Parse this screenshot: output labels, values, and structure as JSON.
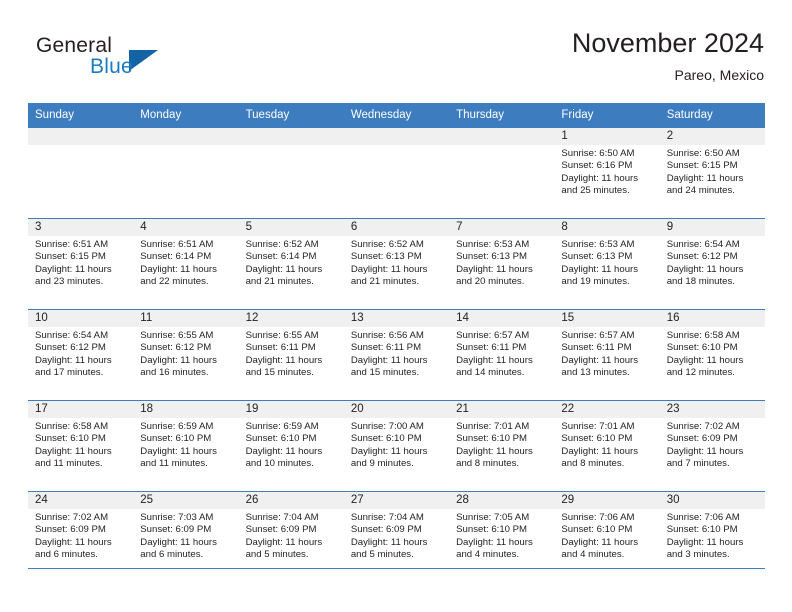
{
  "brand": {
    "word_one": "General",
    "word_two": "Blue",
    "triangle_icon": "triangle-icon",
    "accent_color": "#1d7bc1",
    "triangle_color": "#1464a5"
  },
  "header": {
    "title": "November 2024",
    "location": "Pareo, Mexico"
  },
  "calendar": {
    "header_color": "#3c7cbf",
    "daynum_band_color": "#f0f0f0",
    "weekdays": [
      "Sunday",
      "Monday",
      "Tuesday",
      "Wednesday",
      "Thursday",
      "Friday",
      "Saturday"
    ],
    "weeks": [
      [
        {
          "day": "",
          "blank": true
        },
        {
          "day": "",
          "blank": true
        },
        {
          "day": "",
          "blank": true
        },
        {
          "day": "",
          "blank": true
        },
        {
          "day": "",
          "blank": true
        },
        {
          "day": "1",
          "sunrise": "Sunrise: 6:50 AM",
          "sunset": "Sunset: 6:16 PM",
          "daylight1": "Daylight: 11 hours",
          "daylight2": "and 25 minutes."
        },
        {
          "day": "2",
          "sunrise": "Sunrise: 6:50 AM",
          "sunset": "Sunset: 6:15 PM",
          "daylight1": "Daylight: 11 hours",
          "daylight2": "and 24 minutes."
        }
      ],
      [
        {
          "day": "3",
          "sunrise": "Sunrise: 6:51 AM",
          "sunset": "Sunset: 6:15 PM",
          "daylight1": "Daylight: 11 hours",
          "daylight2": "and 23 minutes."
        },
        {
          "day": "4",
          "sunrise": "Sunrise: 6:51 AM",
          "sunset": "Sunset: 6:14 PM",
          "daylight1": "Daylight: 11 hours",
          "daylight2": "and 22 minutes."
        },
        {
          "day": "5",
          "sunrise": "Sunrise: 6:52 AM",
          "sunset": "Sunset: 6:14 PM",
          "daylight1": "Daylight: 11 hours",
          "daylight2": "and 21 minutes."
        },
        {
          "day": "6",
          "sunrise": "Sunrise: 6:52 AM",
          "sunset": "Sunset: 6:13 PM",
          "daylight1": "Daylight: 11 hours",
          "daylight2": "and 21 minutes."
        },
        {
          "day": "7",
          "sunrise": "Sunrise: 6:53 AM",
          "sunset": "Sunset: 6:13 PM",
          "daylight1": "Daylight: 11 hours",
          "daylight2": "and 20 minutes."
        },
        {
          "day": "8",
          "sunrise": "Sunrise: 6:53 AM",
          "sunset": "Sunset: 6:13 PM",
          "daylight1": "Daylight: 11 hours",
          "daylight2": "and 19 minutes."
        },
        {
          "day": "9",
          "sunrise": "Sunrise: 6:54 AM",
          "sunset": "Sunset: 6:12 PM",
          "daylight1": "Daylight: 11 hours",
          "daylight2": "and 18 minutes."
        }
      ],
      [
        {
          "day": "10",
          "sunrise": "Sunrise: 6:54 AM",
          "sunset": "Sunset: 6:12 PM",
          "daylight1": "Daylight: 11 hours",
          "daylight2": "and 17 minutes."
        },
        {
          "day": "11",
          "sunrise": "Sunrise: 6:55 AM",
          "sunset": "Sunset: 6:12 PM",
          "daylight1": "Daylight: 11 hours",
          "daylight2": "and 16 minutes."
        },
        {
          "day": "12",
          "sunrise": "Sunrise: 6:55 AM",
          "sunset": "Sunset: 6:11 PM",
          "daylight1": "Daylight: 11 hours",
          "daylight2": "and 15 minutes."
        },
        {
          "day": "13",
          "sunrise": "Sunrise: 6:56 AM",
          "sunset": "Sunset: 6:11 PM",
          "daylight1": "Daylight: 11 hours",
          "daylight2": "and 15 minutes."
        },
        {
          "day": "14",
          "sunrise": "Sunrise: 6:57 AM",
          "sunset": "Sunset: 6:11 PM",
          "daylight1": "Daylight: 11 hours",
          "daylight2": "and 14 minutes."
        },
        {
          "day": "15",
          "sunrise": "Sunrise: 6:57 AM",
          "sunset": "Sunset: 6:11 PM",
          "daylight1": "Daylight: 11 hours",
          "daylight2": "and 13 minutes."
        },
        {
          "day": "16",
          "sunrise": "Sunrise: 6:58 AM",
          "sunset": "Sunset: 6:10 PM",
          "daylight1": "Daylight: 11 hours",
          "daylight2": "and 12 minutes."
        }
      ],
      [
        {
          "day": "17",
          "sunrise": "Sunrise: 6:58 AM",
          "sunset": "Sunset: 6:10 PM",
          "daylight1": "Daylight: 11 hours",
          "daylight2": "and 11 minutes."
        },
        {
          "day": "18",
          "sunrise": "Sunrise: 6:59 AM",
          "sunset": "Sunset: 6:10 PM",
          "daylight1": "Daylight: 11 hours",
          "daylight2": "and 11 minutes."
        },
        {
          "day": "19",
          "sunrise": "Sunrise: 6:59 AM",
          "sunset": "Sunset: 6:10 PM",
          "daylight1": "Daylight: 11 hours",
          "daylight2": "and 10 minutes."
        },
        {
          "day": "20",
          "sunrise": "Sunrise: 7:00 AM",
          "sunset": "Sunset: 6:10 PM",
          "daylight1": "Daylight: 11 hours",
          "daylight2": "and 9 minutes."
        },
        {
          "day": "21",
          "sunrise": "Sunrise: 7:01 AM",
          "sunset": "Sunset: 6:10 PM",
          "daylight1": "Daylight: 11 hours",
          "daylight2": "and 8 minutes."
        },
        {
          "day": "22",
          "sunrise": "Sunrise: 7:01 AM",
          "sunset": "Sunset: 6:10 PM",
          "daylight1": "Daylight: 11 hours",
          "daylight2": "and 8 minutes."
        },
        {
          "day": "23",
          "sunrise": "Sunrise: 7:02 AM",
          "sunset": "Sunset: 6:09 PM",
          "daylight1": "Daylight: 11 hours",
          "daylight2": "and 7 minutes."
        }
      ],
      [
        {
          "day": "24",
          "sunrise": "Sunrise: 7:02 AM",
          "sunset": "Sunset: 6:09 PM",
          "daylight1": "Daylight: 11 hours",
          "daylight2": "and 6 minutes."
        },
        {
          "day": "25",
          "sunrise": "Sunrise: 7:03 AM",
          "sunset": "Sunset: 6:09 PM",
          "daylight1": "Daylight: 11 hours",
          "daylight2": "and 6 minutes."
        },
        {
          "day": "26",
          "sunrise": "Sunrise: 7:04 AM",
          "sunset": "Sunset: 6:09 PM",
          "daylight1": "Daylight: 11 hours",
          "daylight2": "and 5 minutes."
        },
        {
          "day": "27",
          "sunrise": "Sunrise: 7:04 AM",
          "sunset": "Sunset: 6:09 PM",
          "daylight1": "Daylight: 11 hours",
          "daylight2": "and 5 minutes."
        },
        {
          "day": "28",
          "sunrise": "Sunrise: 7:05 AM",
          "sunset": "Sunset: 6:10 PM",
          "daylight1": "Daylight: 11 hours",
          "daylight2": "and 4 minutes."
        },
        {
          "day": "29",
          "sunrise": "Sunrise: 7:06 AM",
          "sunset": "Sunset: 6:10 PM",
          "daylight1": "Daylight: 11 hours",
          "daylight2": "and 4 minutes."
        },
        {
          "day": "30",
          "sunrise": "Sunrise: 7:06 AM",
          "sunset": "Sunset: 6:10 PM",
          "daylight1": "Daylight: 11 hours",
          "daylight2": "and 3 minutes."
        }
      ]
    ]
  }
}
